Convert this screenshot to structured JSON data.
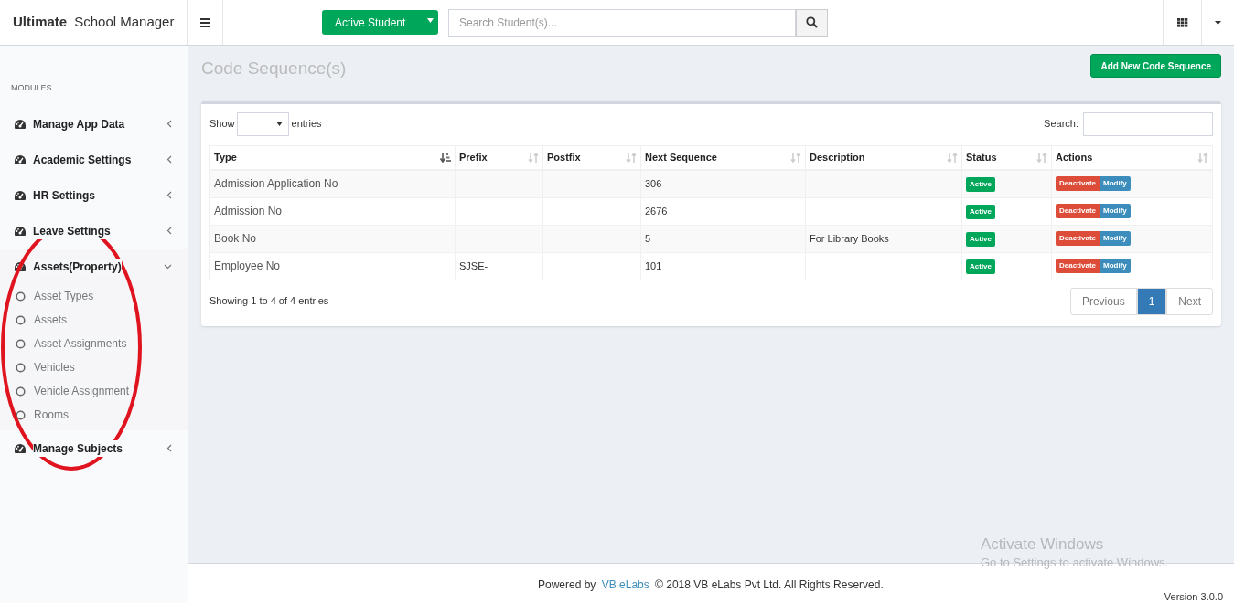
{
  "brand": {
    "bold": "Ultimate",
    "rest": "School Manager"
  },
  "header": {
    "student_filter": "Active Student",
    "search": {
      "placeholder": "Search Student(s)..."
    }
  },
  "sidebar": {
    "heading": "MODULES",
    "items": [
      {
        "label": "Manage App Data",
        "expanded": false
      },
      {
        "label": "Academic Settings",
        "expanded": false
      },
      {
        "label": "HR Settings",
        "expanded": false
      },
      {
        "label": "Leave Settings",
        "expanded": false
      },
      {
        "label": "Assets(Property)",
        "expanded": true,
        "children": [
          {
            "label": "Asset Types"
          },
          {
            "label": "Assets"
          },
          {
            "label": "Asset Assignments"
          },
          {
            "label": "Vehicles"
          },
          {
            "label": "Vehicle Assignment"
          },
          {
            "label": "Rooms"
          }
        ]
      },
      {
        "label": "Manage Subjects",
        "expanded": false
      }
    ]
  },
  "page_title": "Code Sequence(s)",
  "add_button": "Add New Code Sequence",
  "length_menu": {
    "before": "Show",
    "after": "entries"
  },
  "search_label": "Search:",
  "table": {
    "columns": [
      {
        "label": "Type",
        "sorted": true
      },
      {
        "label": "Prefix",
        "sorted": false
      },
      {
        "label": "Postfix",
        "sorted": false
      },
      {
        "label": "Next Sequence",
        "sorted": false
      },
      {
        "label": "Description",
        "sorted": false
      },
      {
        "label": "Status",
        "sorted": false
      },
      {
        "label": "Actions",
        "sorted": false
      }
    ],
    "rows": [
      {
        "type": "Admission Application No",
        "prefix": "",
        "postfix": "",
        "next": "306",
        "description": "",
        "status": "Active",
        "actions": [
          "Deactivate",
          "Modify"
        ]
      },
      {
        "type": "Admission No",
        "prefix": "",
        "postfix": "",
        "next": "2676",
        "description": "",
        "status": "Active",
        "actions": [
          "Deactivate",
          "Modify"
        ]
      },
      {
        "type": "Book No",
        "prefix": "",
        "postfix": "",
        "next": "5",
        "description": "For Library Books",
        "status": "Active",
        "actions": [
          "Deactivate",
          "Modify"
        ]
      },
      {
        "type": "Employee No",
        "prefix": "SJSE-",
        "postfix": "",
        "next": "101",
        "description": "",
        "status": "Active",
        "actions": [
          "Deactivate",
          "Modify"
        ]
      }
    ]
  },
  "info": "Showing 1 to 4 of 4 entries",
  "pagination": [
    {
      "label": "Previous",
      "selected": false
    },
    {
      "label": "1",
      "selected": true
    },
    {
      "label": "Next",
      "selected": false
    }
  ],
  "footer": {
    "prefix": "Powered by",
    "link": "VB eLabs",
    "rest": "© 2018 VB eLabs Pvt Ltd. All Rights Reserved.",
    "version": "Version 3.0.0"
  },
  "os_notice": {
    "title": "Activate Windows",
    "text": "Go to Settings to activate Windows."
  }
}
